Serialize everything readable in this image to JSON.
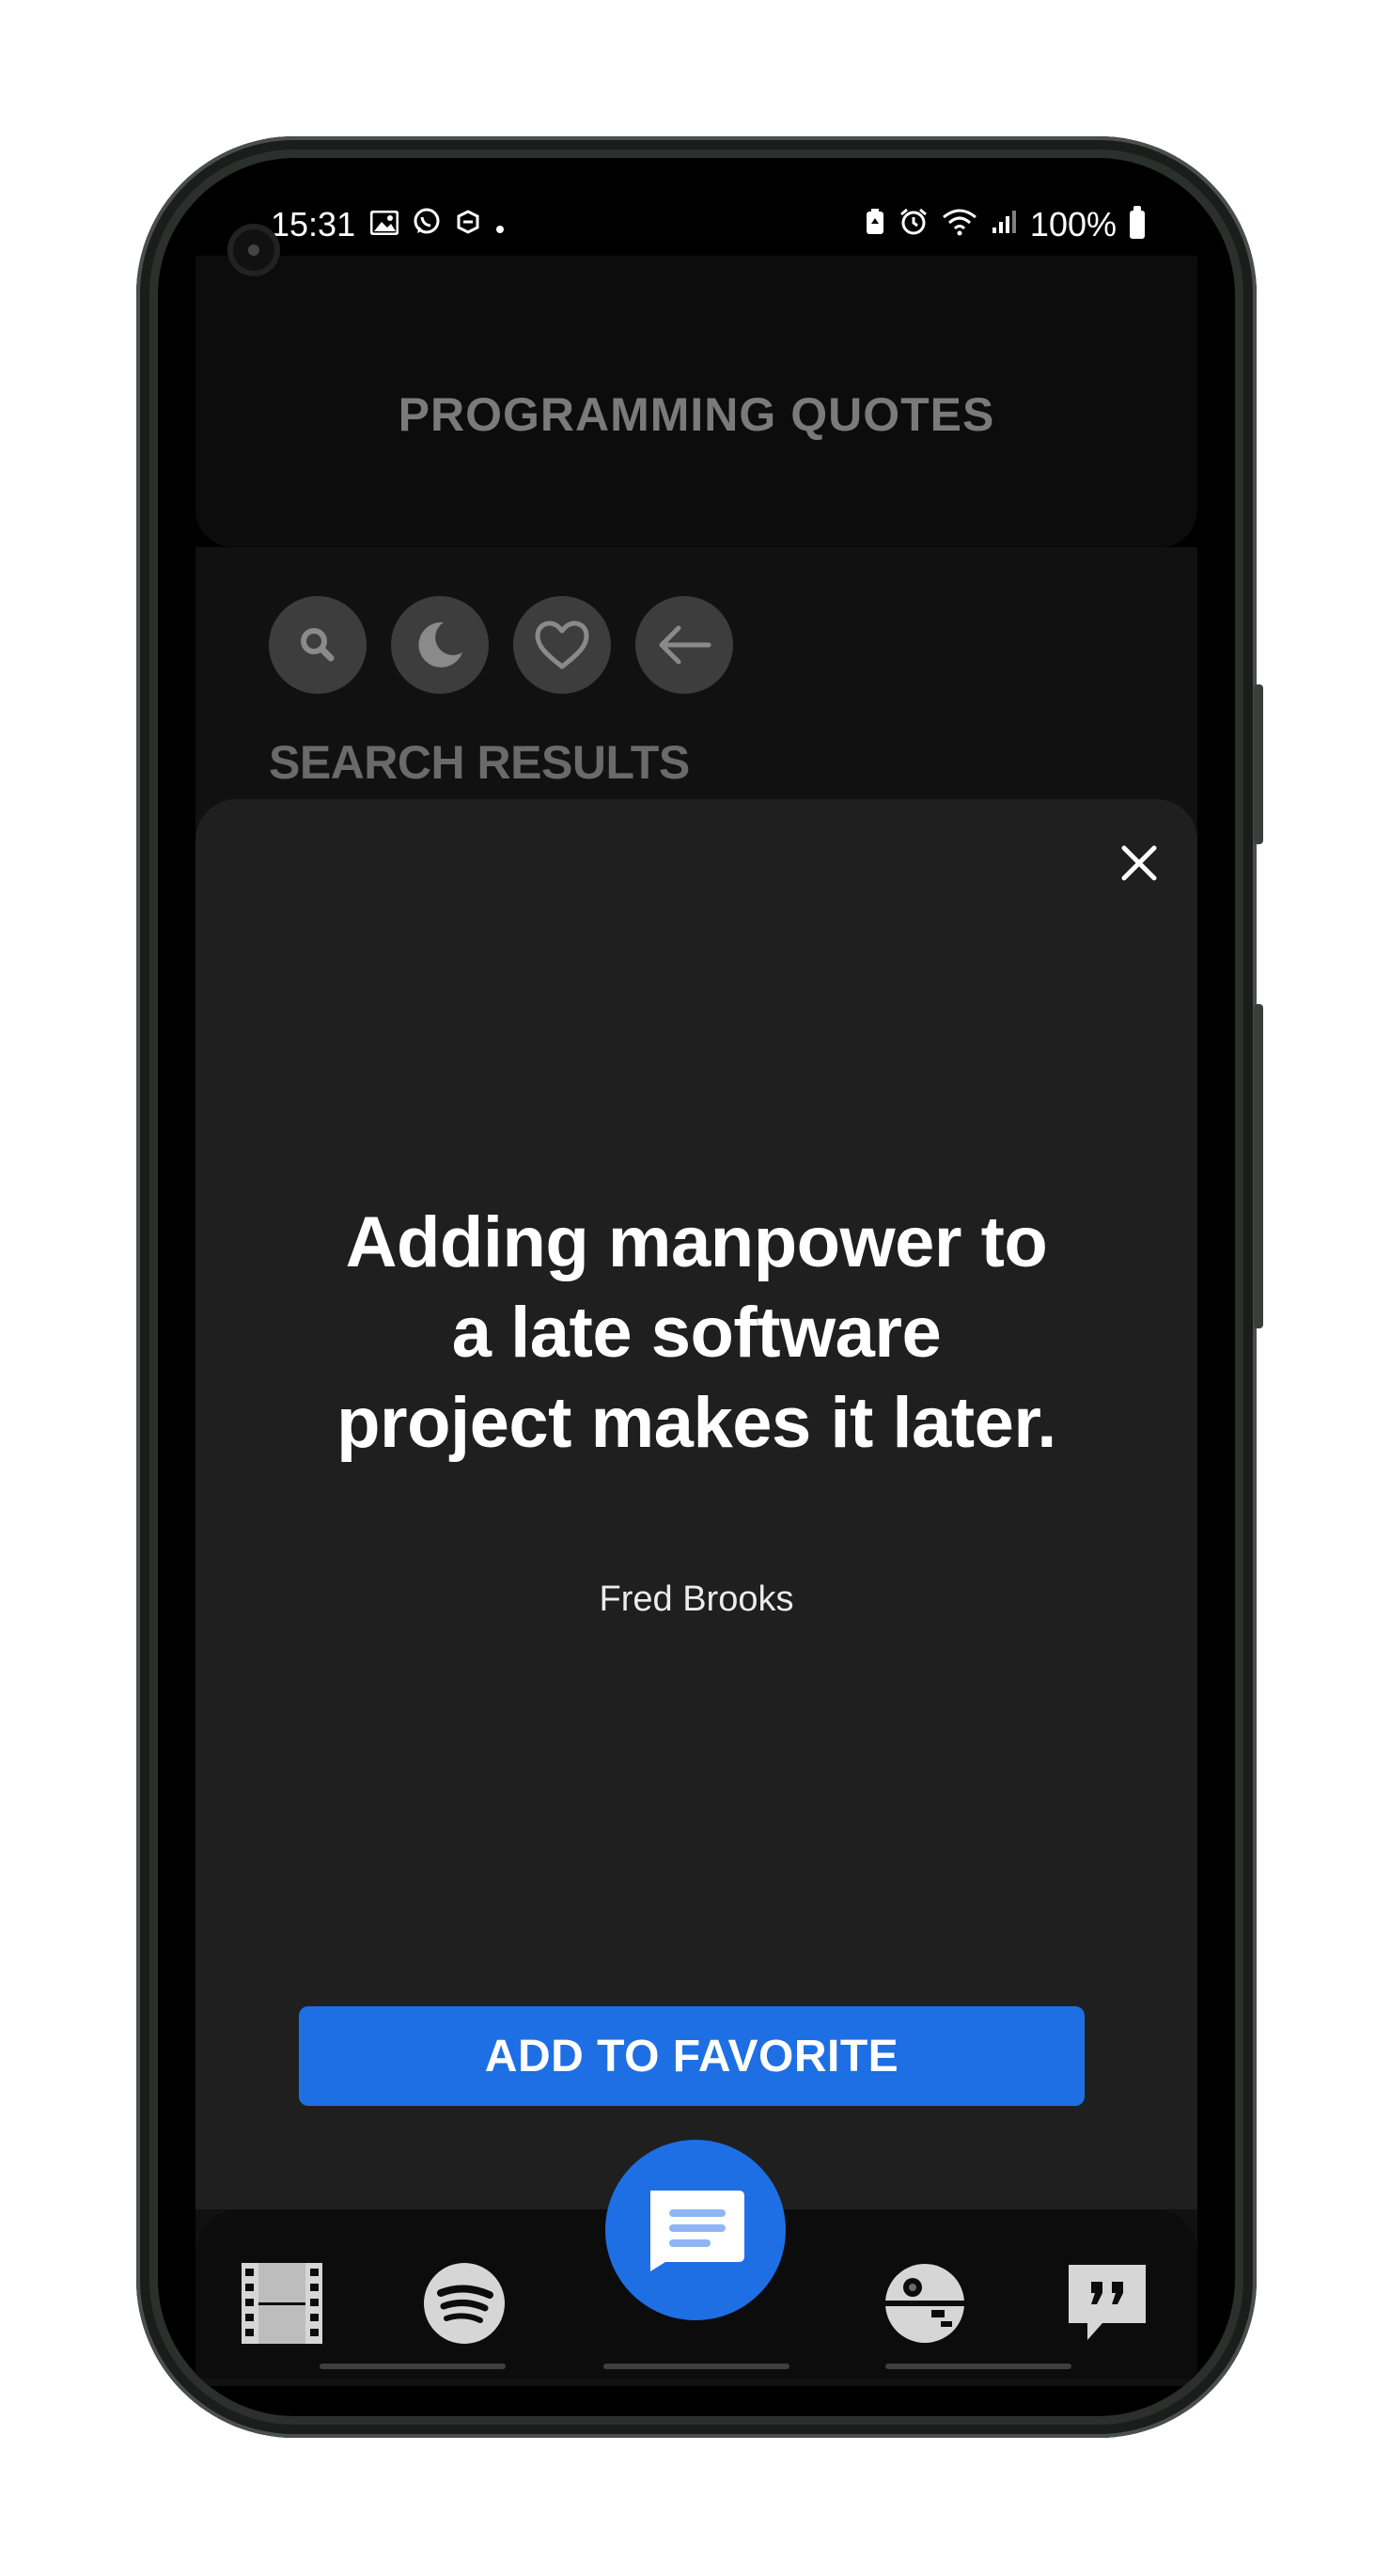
{
  "status_bar": {
    "time": "15:31",
    "battery": "100%",
    "left_icons": [
      "image-icon",
      "whatsapp-icon",
      "app-icon",
      "dot-icon"
    ],
    "right_icons": [
      "battery-saver-icon",
      "alarm-icon",
      "wifi-icon",
      "signal-icon"
    ]
  },
  "header": {
    "title": "PROGRAMMING QUOTES"
  },
  "toolbar": {
    "buttons": [
      "search-icon",
      "moon-icon",
      "heart-icon",
      "arrow-left-icon"
    ]
  },
  "section": {
    "label": "SEARCH RESULTS"
  },
  "modal": {
    "quote": "Adding manpower to a late software project makes it later.",
    "author": "Fred Brooks",
    "favorite_label": "ADD TO FAVORITE"
  },
  "bottom_nav": {
    "items": [
      "film-icon",
      "spotify-icon",
      "messages-icon",
      "death-star-icon",
      "quote-icon"
    ],
    "accent": "#1e6fe4"
  },
  "colors": {
    "background": "#000000",
    "sheet": "#1f1f1f",
    "accent": "#1e6fe4",
    "muted_text": "#7a7a7a"
  }
}
